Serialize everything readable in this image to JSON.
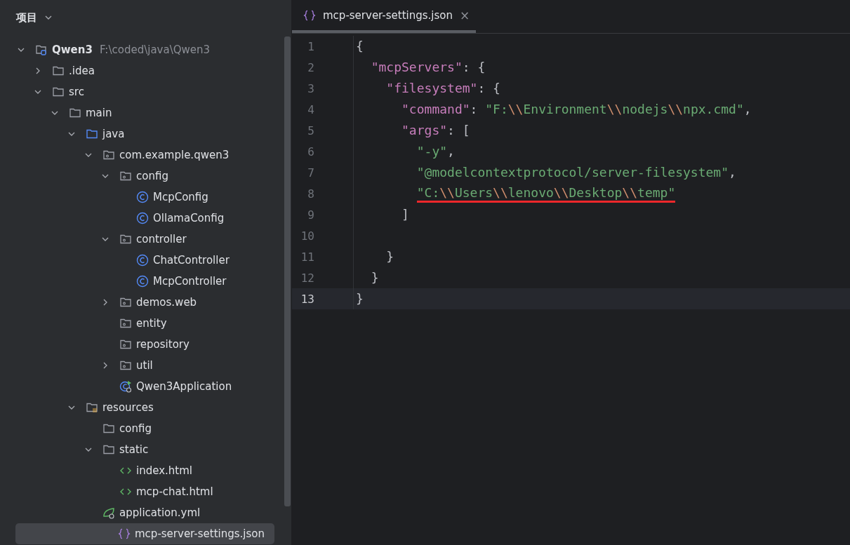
{
  "sidebar": {
    "title": "项目",
    "tree": [
      {
        "label": "Qwen3",
        "path": "F:\\coded\\java\\Qwen3",
        "kind": "project",
        "expanded": true,
        "selected": false,
        "children": [
          {
            "label": ".idea",
            "kind": "folder",
            "expanded": false,
            "selected": false
          },
          {
            "label": "src",
            "kind": "folder",
            "expanded": true,
            "selected": false,
            "children": [
              {
                "label": "main",
                "kind": "folder",
                "expanded": true,
                "selected": false,
                "children": [
                  {
                    "label": "java",
                    "kind": "source",
                    "expanded": true,
                    "selected": false,
                    "children": [
                      {
                        "label": "com.example.qwen3",
                        "kind": "package",
                        "expanded": true,
                        "selected": false,
                        "children": [
                          {
                            "label": "config",
                            "kind": "package",
                            "expanded": true,
                            "selected": false,
                            "children": [
                              {
                                "label": "McpConfig",
                                "kind": "class",
                                "selected": false
                              },
                              {
                                "label": "OllamaConfig",
                                "kind": "class",
                                "selected": false
                              }
                            ]
                          },
                          {
                            "label": "controller",
                            "kind": "package",
                            "expanded": true,
                            "selected": false,
                            "children": [
                              {
                                "label": "ChatController",
                                "kind": "class",
                                "selected": false
                              },
                              {
                                "label": "McpController",
                                "kind": "class",
                                "selected": false
                              }
                            ]
                          },
                          {
                            "label": "demos.web",
                            "kind": "package",
                            "expanded": false,
                            "selected": false
                          },
                          {
                            "label": "entity",
                            "kind": "package",
                            "selected": false
                          },
                          {
                            "label": "repository",
                            "kind": "package",
                            "selected": false
                          },
                          {
                            "label": "util",
                            "kind": "package",
                            "expanded": false,
                            "selected": false
                          },
                          {
                            "label": "Qwen3Application",
                            "kind": "app",
                            "selected": false
                          }
                        ]
                      }
                    ]
                  },
                  {
                    "label": "resources",
                    "kind": "resources",
                    "expanded": true,
                    "selected": false,
                    "children": [
                      {
                        "label": "config",
                        "kind": "folder",
                        "selected": false
                      },
                      {
                        "label": "static",
                        "kind": "folder",
                        "expanded": true,
                        "selected": false,
                        "children": [
                          {
                            "label": "index.html",
                            "kind": "html",
                            "selected": false
                          },
                          {
                            "label": "mcp-chat.html",
                            "kind": "html",
                            "selected": false
                          }
                        ]
                      },
                      {
                        "label": "application.yml",
                        "kind": "spring",
                        "selected": false
                      },
                      {
                        "label": "mcp-server-settings.json",
                        "kind": "json",
                        "selected": true
                      }
                    ]
                  }
                ]
              }
            ]
          }
        ]
      }
    ]
  },
  "editor": {
    "tabs": [
      {
        "label": "mcp-server-settings.json",
        "close": "×",
        "selected": true
      }
    ],
    "lines": [
      {
        "number": "1",
        "current": false,
        "tokens": [
          {
            "t": "{",
            "kind": "punct"
          }
        ]
      },
      {
        "number": "2",
        "current": false,
        "tokens": [
          {
            "t": "  \"mcpServers\"",
            "kind": "key"
          },
          {
            "t": ": {",
            "kind": "punct"
          }
        ]
      },
      {
        "number": "3",
        "current": false,
        "tokens": [
          {
            "t": "    \"filesystem\"",
            "kind": "key"
          },
          {
            "t": ": {",
            "kind": "punct"
          }
        ]
      },
      {
        "number": "4",
        "current": false,
        "tokens": [
          {
            "t": "      \"command\"",
            "kind": "key"
          },
          {
            "t": ": ",
            "kind": "punct"
          },
          {
            "t": "\"F:",
            "kind": "string"
          },
          {
            "t": "\\\\",
            "kind": "escape"
          },
          {
            "t": "Environment",
            "kind": "string"
          },
          {
            "t": "\\\\",
            "kind": "escape"
          },
          {
            "t": "nodejs",
            "kind": "string"
          },
          {
            "t": "\\\\",
            "kind": "escape"
          },
          {
            "t": "npx.cmd\"",
            "kind": "string"
          },
          {
            "t": ",",
            "kind": "punct"
          }
        ]
      },
      {
        "number": "5",
        "current": false,
        "tokens": [
          {
            "t": "      \"args\"",
            "kind": "key"
          },
          {
            "t": ": [",
            "kind": "punct"
          }
        ]
      },
      {
        "number": "6",
        "current": false,
        "tokens": [
          {
            "t": "        \"-y\"",
            "kind": "string"
          },
          {
            "t": ",",
            "kind": "punct"
          }
        ]
      },
      {
        "number": "7",
        "current": false,
        "tokens": [
          {
            "t": "        \"@modelcontextprotocol/server-filesystem\"",
            "kind": "string"
          },
          {
            "t": ",",
            "kind": "punct"
          }
        ]
      },
      {
        "number": "8",
        "current": false,
        "underlined": true,
        "tokens": [
          {
            "t": "        \"C:",
            "kind": "string"
          },
          {
            "t": "\\\\",
            "kind": "escape"
          },
          {
            "t": "Users",
            "kind": "string"
          },
          {
            "t": "\\\\",
            "kind": "escape"
          },
          {
            "t": "lenovo",
            "kind": "string"
          },
          {
            "t": "\\\\",
            "kind": "escape"
          },
          {
            "t": "Desktop",
            "kind": "string"
          },
          {
            "t": "\\\\",
            "kind": "escape"
          },
          {
            "t": "temp\"",
            "kind": "string"
          }
        ]
      },
      {
        "number": "9",
        "current": false,
        "tokens": [
          {
            "t": "      ]",
            "kind": "punct"
          }
        ]
      },
      {
        "number": "10",
        "current": false
      },
      {
        "number": "11",
        "current": false,
        "tokens": [
          {
            "t": "    }",
            "kind": "punct"
          }
        ]
      },
      {
        "number": "12",
        "current": false,
        "tokens": [
          {
            "t": "  }",
            "kind": "punct"
          }
        ]
      },
      {
        "number": "13",
        "current": true,
        "tokens": [
          {
            "t": "}",
            "kind": "punct"
          }
        ]
      }
    ]
  }
}
